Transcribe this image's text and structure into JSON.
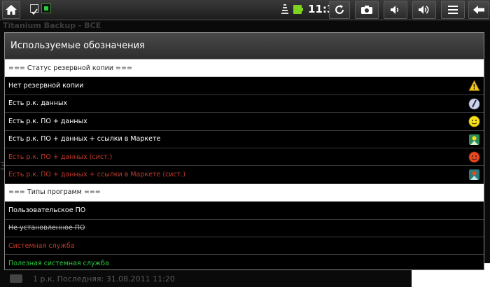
{
  "status_bar": {
    "time": "11:35",
    "icons": [
      "home-icon",
      "notification-checkbox-icon",
      "notification-screen-icon",
      "wifi-icon",
      "battery-icon",
      "refresh-icon",
      "camera-icon",
      "volume-down-icon",
      "volume-up-icon",
      "menu-icon",
      "back-icon"
    ]
  },
  "background": {
    "app_title": "Titanium Backup - ВСЕ",
    "ghost_char": "3",
    "last_row": "1 р.к. Последняя: 31.08.2011 11:20"
  },
  "dialog": {
    "title": "Используемые обозначения",
    "rows": [
      {
        "type": "header",
        "text": "=== Статус резервной копии ==="
      },
      {
        "type": "white",
        "text": "Нет резервной копии",
        "icon": "warning-icon"
      },
      {
        "type": "white",
        "text": "Есть р.к. данных",
        "icon": "data-disk-icon"
      },
      {
        "type": "white",
        "text": "Есть р.к. ПО + данных",
        "icon": "yellow-smiley-icon"
      },
      {
        "type": "white",
        "text": "Есть р.к. ПО + данных + ссылки в Маркете",
        "icon": "market-green-icon"
      },
      {
        "type": "red",
        "text": "Есть р.к. ПО + данных (сист.)",
        "icon": "red-smiley-icon"
      },
      {
        "type": "red",
        "text": "Есть р.к. ПО + данных + ссылки в Маркете (сист.)",
        "icon": "market-teal-icon"
      },
      {
        "type": "header",
        "text": "=== Типы программ ==="
      },
      {
        "type": "white",
        "text": "Пользовательское ПО"
      },
      {
        "type": "strike",
        "text": "Не установленное ПО"
      },
      {
        "type": "red",
        "text": "Системная служба"
      },
      {
        "type": "green",
        "text": "Полезная системная служба"
      }
    ]
  },
  "colors": {
    "system_red": "#c0392b",
    "useful_green": "#2ecc40",
    "header_bg": "#ffffff"
  }
}
